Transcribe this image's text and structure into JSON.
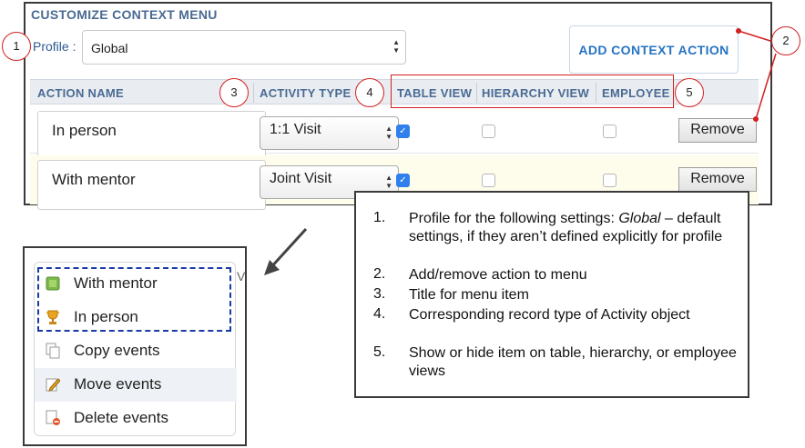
{
  "panel_title": "CUSTOMIZE CONTEXT MENU",
  "profile": {
    "label": "Profile :",
    "value": "Global"
  },
  "add_button": "ADD CONTEXT ACTION",
  "columns": [
    "ACTION NAME",
    "ACTIVITY TYPE",
    "TABLE VIEW",
    "HIERARCHY VIEW",
    "EMPLOYEE"
  ],
  "rows": [
    {
      "name": "In person",
      "activity_type": "1:1 Visit",
      "table_view": true,
      "hierarchy_view": false,
      "employee": false,
      "remove_label": "Remove"
    },
    {
      "name": "With mentor",
      "activity_type": "Joint Visit",
      "table_view": true,
      "hierarchy_view": false,
      "employee": false,
      "remove_label": "Remove"
    }
  ],
  "callouts": [
    "1",
    "2",
    "3",
    "4",
    "5"
  ],
  "context_menu": {
    "items": [
      {
        "label": "With mentor",
        "icon": "green-square-icon"
      },
      {
        "label": "In person",
        "icon": "trophy-icon"
      },
      {
        "label": "Copy events",
        "icon": "copy-icon"
      },
      {
        "label": "Move events",
        "icon": "edit-icon"
      },
      {
        "label": "Delete events",
        "icon": "delete-doc-icon"
      }
    ],
    "fragment": "V"
  },
  "notes": [
    {
      "num": "1.",
      "text_before": "Profile for the following settings: ",
      "text_italic": "Global",
      "text_after": " – default settings, if they aren’t defined explicitly for profile"
    },
    {
      "num": "2.",
      "text": "Add/remove action to menu"
    },
    {
      "num": "3.",
      "text": "Title for menu item"
    },
    {
      "num": "4.",
      "text": "Corresponding record type of Activity object"
    },
    {
      "num": "5.",
      "text": "Show or hide item on table, hierarchy, or employee views"
    }
  ],
  "colors": {
    "header_text": "#4a6a93",
    "accent_blue": "#2573c4",
    "annotation_red": "#d32020",
    "dashed_blue": "#1a3aa8",
    "row_highlight": "#fefcea"
  }
}
